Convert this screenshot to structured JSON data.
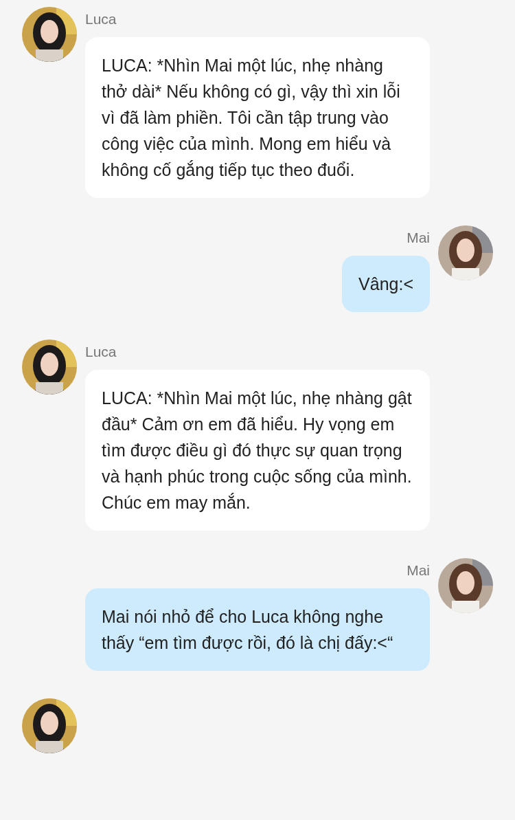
{
  "messages": [
    {
      "kind": "incoming",
      "name": "Luca",
      "text": "LUCA: *Nhìn Mai một lúc, nhẹ nhàng thở dài* Nếu không có gì, vậy thì xin lỗi vì đã làm phiền. Tôi cần tập trung vào công việc của mình. Mong em hiểu và không cố gắng tiếp tục theo đuổi."
    },
    {
      "kind": "outgoing",
      "name": "Mai",
      "text": "Vâng:<"
    },
    {
      "kind": "incoming",
      "name": "Luca",
      "text": "LUCA: *Nhìn Mai một lúc, nhẹ nhàng gật đầu* Cảm ơn em đã hiểu. Hy vọng em tìm được điều gì đó thực sự quan trọng và hạnh phúc trong cuộc sống của mình. Chúc em may mắn."
    },
    {
      "kind": "outgoing",
      "name": "Mai",
      "text": "Mai nói nhỏ để cho Luca không nghe thấy “em tìm được rồi, đó là chị đấy:<“"
    },
    {
      "kind": "incoming"
    }
  ]
}
